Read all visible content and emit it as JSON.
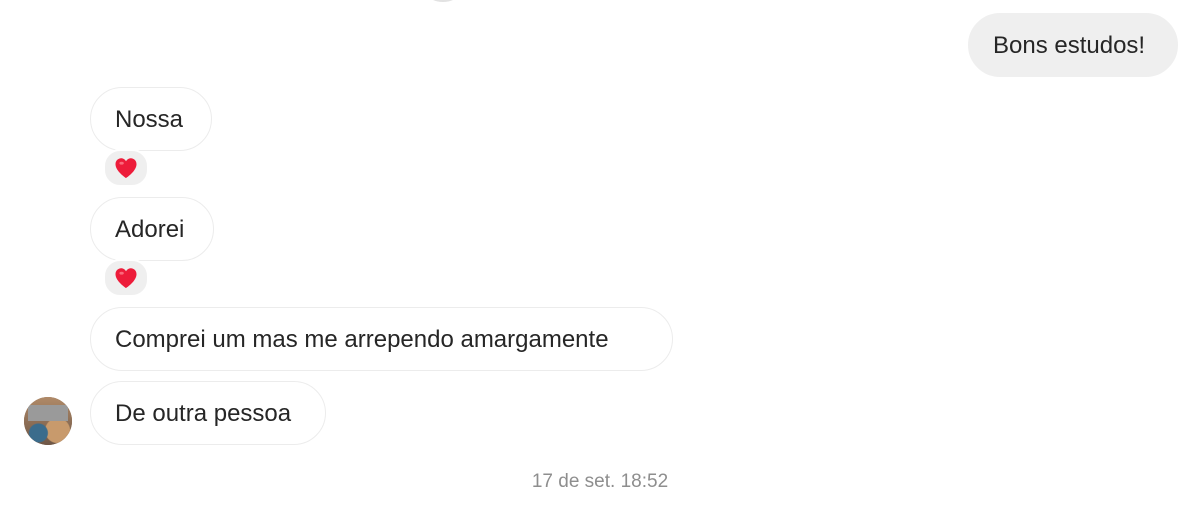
{
  "messages": {
    "outgoing_1": "Bons estudos!",
    "incoming_1": "Nossa",
    "incoming_2": "Adorei",
    "incoming_3": "Comprei um mas me arrependo amargamente",
    "incoming_4": "De outra pessoa"
  },
  "reactions": {
    "incoming_1": "heart-icon",
    "incoming_2": "heart-icon"
  },
  "timestamp": "17 de set. 18:52",
  "colors": {
    "heart": "#ed1c3a",
    "outgoing_bubble": "#efefef",
    "incoming_border": "#ececec",
    "timestamp_text": "#8e8e8e"
  }
}
